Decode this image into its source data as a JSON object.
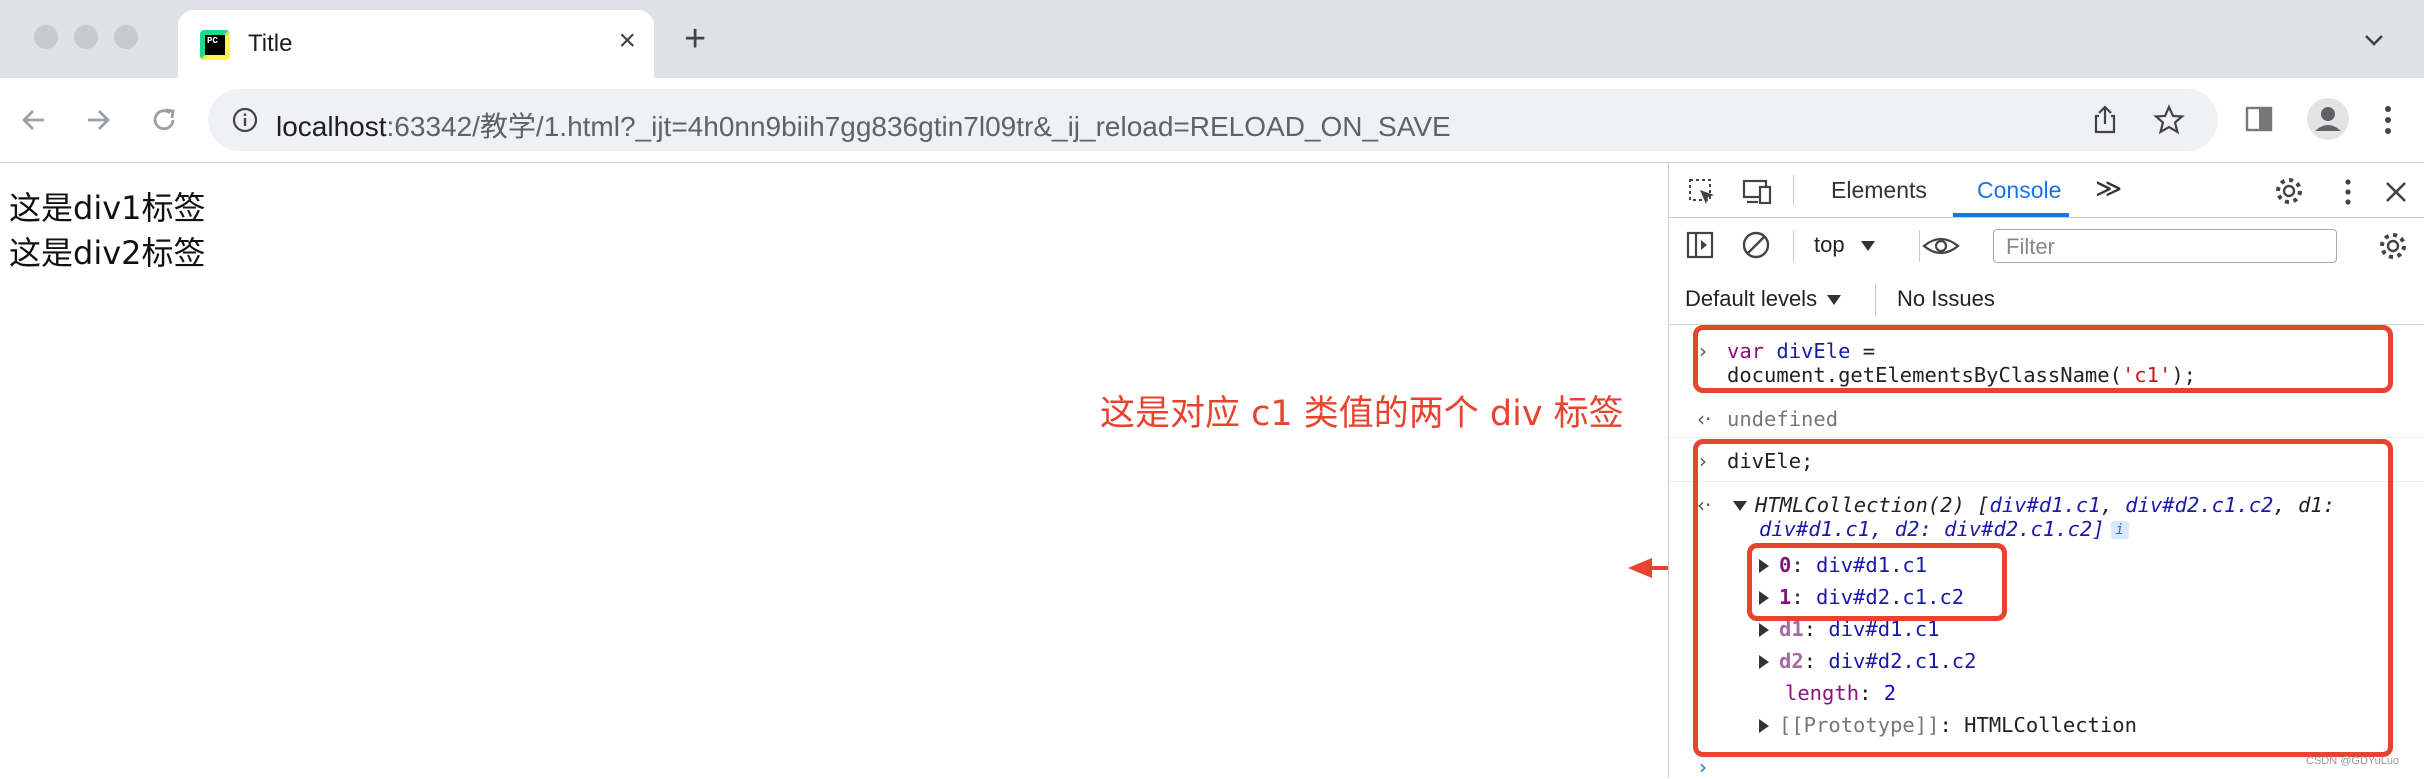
{
  "browser": {
    "tab": {
      "favicon_text": "PC",
      "title": "Title",
      "close": "×"
    },
    "new_tab": "+",
    "address": {
      "host": "localhost",
      "rest": ":63342/教学/1.html?_ijt=4h0nn9biih7gg836gtin7l09tr&_ij_reload=RELOAD_ON_SAVE"
    }
  },
  "page": {
    "lines": [
      "这是div1标签",
      "这是div2标签"
    ],
    "annotation": "这是对应 c1 类值的两个 div 标签"
  },
  "devtools": {
    "tabs": {
      "elements": "Elements",
      "console": "Console",
      "more": "≫"
    },
    "context": "top",
    "filter_placeholder": "Filter",
    "levels": "Default levels",
    "issues": "No Issues",
    "console": {
      "cmd1": {
        "kw": "var",
        "name": "divEle",
        "eq": " =",
        "line2a": "document.getElementsByClassName(",
        "arg": "'c1'",
        "line2b": ");"
      },
      "result1": "undefined",
      "cmd2": "divEle;",
      "collection_header_a": "HTMLCollection(2) [",
      "collection_el1": "div#d1.c1",
      "collection_sep": ", ",
      "collection_el2": "div#d2.c1.c2",
      "collection_tail": ", d1:",
      "collection_line2": "div#d1.c1, d2: div#d2.c1.c2]",
      "info": "i",
      "items": [
        {
          "key": "0",
          "value": "div#d1.c1"
        },
        {
          "key": "1",
          "value": "div#d2.c1.c2"
        },
        {
          "key": "d1",
          "value": "div#d1.c1"
        },
        {
          "key": "d2",
          "value": "div#d2.c1.c2"
        }
      ],
      "length_key": "length",
      "length_value": "2",
      "proto_key": "[[Prototype]]",
      "proto_value": "HTMLCollection"
    }
  },
  "watermark": "CSDN @GDYuLuo",
  "colors": {
    "highlight": "#e8432e",
    "accent": "#1a73e8"
  }
}
